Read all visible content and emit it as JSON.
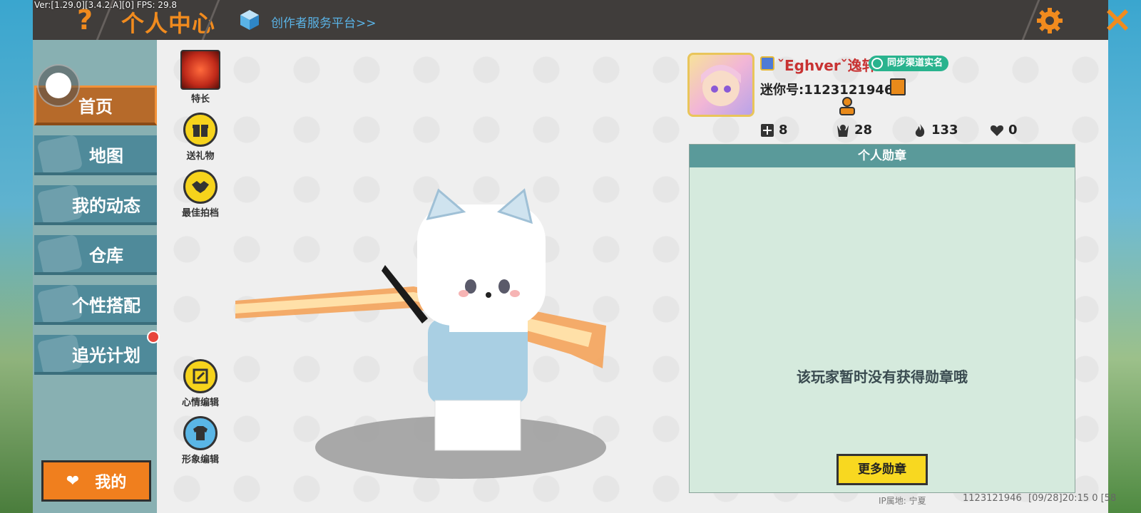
{
  "version_text": "Ver:[1.29.0][3.4.2.A][0] FPS: 29.8",
  "header": {
    "help_icon": "question-icon",
    "title": "个人中心",
    "creator_link": "创作者服务平台>>",
    "settings_icon": "gear-icon",
    "close_icon": "close-icon",
    "accent_color": "#f18b1e"
  },
  "sidebar": {
    "items": [
      {
        "label": "首页",
        "icon": "home-icon",
        "active": true
      },
      {
        "label": "地图",
        "icon": "map-icon"
      },
      {
        "label": "我的动态",
        "icon": "bell-icon"
      },
      {
        "label": "仓库",
        "icon": "warehouse-icon"
      },
      {
        "label": "个性搭配",
        "icon": "outfit-icon"
      },
      {
        "label": "追光计划",
        "icon": "plan-icon"
      }
    ],
    "mine_button": "我的"
  },
  "actions": {
    "specialty": "特长",
    "send_gift": "送礼物",
    "best_partner": "最佳拍档",
    "mood_edit": "心情编辑",
    "image_edit": "形象编辑"
  },
  "profile": {
    "nickname": "ˇEghverˇ逸轩",
    "sync_badge": "同步渠道实名",
    "mini_id": "迷你号:1123121946",
    "stats": {
      "likes": "8",
      "fans": "28",
      "heat": "133",
      "gifts": "0"
    }
  },
  "medals": {
    "header": "个人勋章",
    "empty_text": "该玩家暂时没有获得勋章哦",
    "more_button": "更多勋章"
  },
  "footer": {
    "ip_location": "IP属地: 宁夏",
    "uid": "1123121946",
    "time": "[09/28]20:15 0 [58"
  }
}
